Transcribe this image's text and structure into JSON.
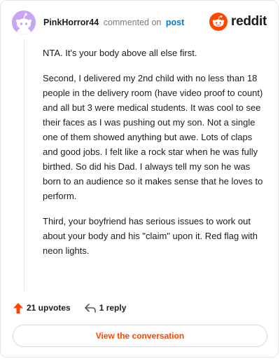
{
  "header": {
    "username": "PinkHorror44",
    "action": "commented on",
    "post_link": "post",
    "brand": "reddit"
  },
  "comment": {
    "paragraphs": [
      "NTA. It's your body above all else first.",
      "Second, I delivered my 2nd child with no less than 18 people in the delivery room (have video proof to count) and all but 3 were medical students. It was cool to see their faces as I was pushing out my son. Not a single one of them showed anything but awe. Lots of claps and good jobs. I felt like a rock star when he was fully birthed. So did his Dad. I always tell my son he was born to an audience so it makes sense that he loves to perform.",
      "Third, your boyfriend has serious issues to work out about your body and his \"claim\" upon it. Red flag with neon lights."
    ]
  },
  "meta": {
    "upvotes": "21 upvotes",
    "replies": "1 reply"
  },
  "cta": {
    "label": "View the conversation"
  },
  "icons": {
    "upvote": "upvote-arrow-icon",
    "reply": "reply-arrow-icon",
    "logo": "reddit-snoo-icon",
    "avatar": "snoo-avatar-icon"
  },
  "colors": {
    "brand": "#ff4500",
    "link": "#0079d3",
    "avatar_bg": "#c9a6f2",
    "text": "#1c1c1c",
    "muted": "#787c7e",
    "border": "#e4e6e8"
  }
}
